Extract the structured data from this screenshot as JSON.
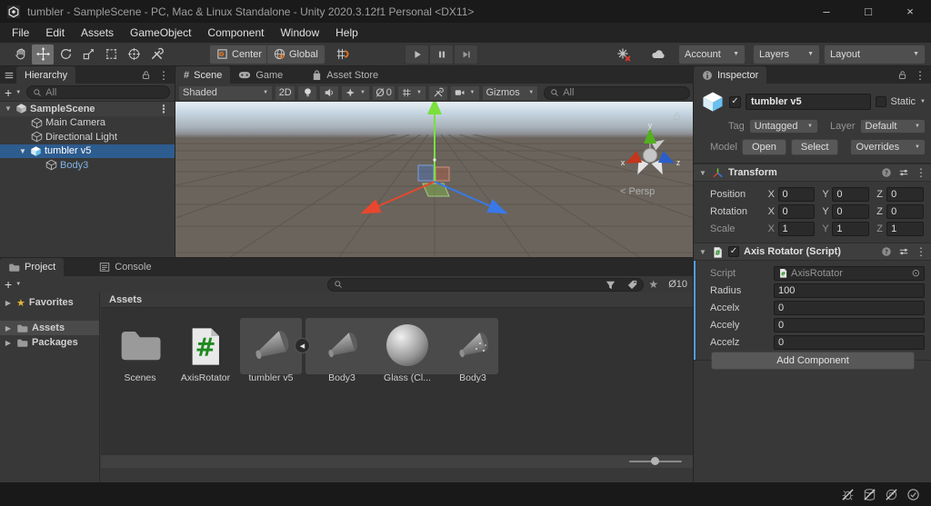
{
  "window": {
    "title": "tumbler - SampleScene - PC, Mac & Linux Standalone - Unity 2020.3.12f1 Personal <DX11>",
    "controls": {
      "minimize": "–",
      "maximize": "□",
      "close": "×"
    }
  },
  "menu": {
    "items": [
      "File",
      "Edit",
      "Assets",
      "GameObject",
      "Component",
      "Window",
      "Help"
    ]
  },
  "toolbar": {
    "center_label": "Center",
    "global_label": "Global",
    "account_label": "Account",
    "layers_label": "Layers",
    "layout_label": "Layout"
  },
  "hierarchy": {
    "tab": "Hierarchy",
    "search_placeholder": "All",
    "items": [
      {
        "label": "SampleScene"
      },
      {
        "label": "Main Camera"
      },
      {
        "label": "Directional Light"
      },
      {
        "label": "tumbler v5"
      },
      {
        "label": "Body3"
      }
    ]
  },
  "scene": {
    "tabs": [
      "Scene",
      "Game",
      "Asset Store"
    ],
    "shading_mode": "Shaded",
    "mode_2d": "2D",
    "hidden_count": "0",
    "gizmos_label": "Gizmos",
    "search_placeholder": "All",
    "axis_labels": {
      "x": "x",
      "y": "y",
      "z": "z"
    },
    "projection_label": "< Persp"
  },
  "inspector": {
    "tab": "Inspector",
    "object_name": "tumbler v5",
    "static_label": "Static",
    "tag_label": "Tag",
    "tag_value": "Untagged",
    "layer_label": "Layer",
    "layer_value": "Default",
    "model_label": "Model",
    "open_label": "Open",
    "select_label": "Select",
    "overrides_label": "Overrides",
    "transform": {
      "title": "Transform",
      "axis": [
        "X",
        "Y",
        "Z"
      ],
      "rows": [
        {
          "label": "Position",
          "x": "0",
          "y": "0",
          "z": "0"
        },
        {
          "label": "Rotation",
          "x": "0",
          "y": "0",
          "z": "0"
        },
        {
          "label": "Scale",
          "x": "1",
          "y": "1",
          "z": "1"
        }
      ]
    },
    "script_component": {
      "title": "Axis Rotator (Script)",
      "fields": [
        {
          "label": "Script",
          "value": "AxisRotator"
        },
        {
          "label": "Radius",
          "value": "100"
        },
        {
          "label": "Accelx",
          "value": "0"
        },
        {
          "label": "Accely",
          "value": "0"
        },
        {
          "label": "Accelz",
          "value": "0"
        }
      ]
    },
    "add_component_label": "Add Component"
  },
  "project": {
    "tabs": [
      "Project",
      "Console"
    ],
    "tree": [
      {
        "label": "Favorites"
      },
      {
        "label": "Assets"
      },
      {
        "label": "Packages"
      }
    ],
    "breadcrumb": "Assets",
    "hidden_count": "10",
    "assets": [
      {
        "name": "Scenes"
      },
      {
        "name": "AxisRotator"
      },
      {
        "name": "tumbler v5"
      },
      {
        "name": "Body3"
      },
      {
        "name": "Glass (Cl..."
      },
      {
        "name": "Body3"
      }
    ]
  },
  "colors": {
    "selection": "#2d5c8f",
    "panel": "#383838",
    "axis_x": "#d8402a",
    "axis_y": "#6ec622",
    "axis_z": "#2e6bdb"
  }
}
